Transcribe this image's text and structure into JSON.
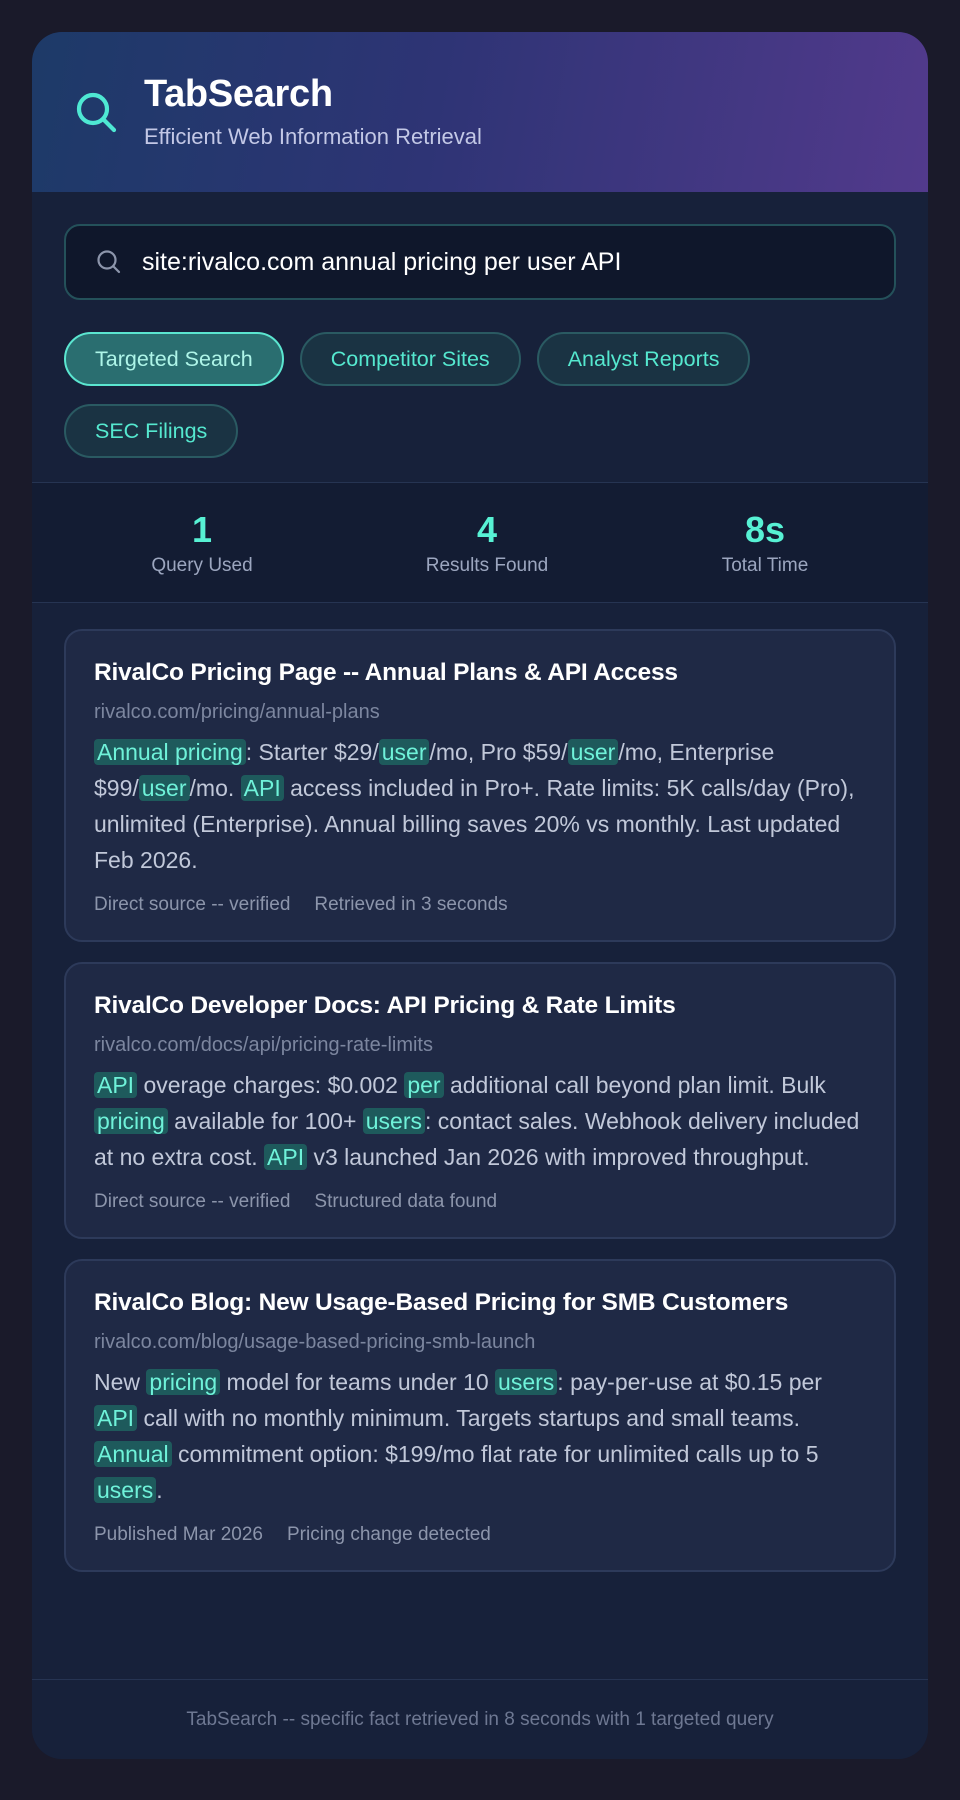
{
  "app": {
    "title": "TabSearch",
    "subtitle": "Efficient Web Information Retrieval",
    "logo_icon": "search-icon"
  },
  "search": {
    "query": "site:rivalco.com annual pricing per user API",
    "icon": "search-icon"
  },
  "filters": [
    {
      "label": "Targeted Search",
      "active": true
    },
    {
      "label": "Competitor Sites",
      "active": false
    },
    {
      "label": "Analyst Reports",
      "active": false
    },
    {
      "label": "SEC Filings",
      "active": false
    }
  ],
  "stats": [
    {
      "value": "1",
      "label": "Query Used"
    },
    {
      "value": "4",
      "label": "Results Found"
    },
    {
      "value": "8s",
      "label": "Total Time"
    }
  ],
  "results": [
    {
      "title": "RivalCo Pricing Page -- Annual Plans & API Access",
      "url": "rivalco.com/pricing/annual-plans",
      "snippet": [
        {
          "t": "Annual pricing",
          "h": true
        },
        {
          "t": ": Starter $29/"
        },
        {
          "t": "user",
          "h": true
        },
        {
          "t": "/mo, Pro $59/"
        },
        {
          "t": "user",
          "h": true
        },
        {
          "t": "/mo, Enterprise $99/"
        },
        {
          "t": "user",
          "h": true
        },
        {
          "t": "/mo. "
        },
        {
          "t": "API",
          "h": true
        },
        {
          "t": " access included in Pro+. Rate limits: 5K calls/day (Pro), unlimited (Enterprise). Annual billing saves 20% vs monthly. Last updated Feb 2026."
        }
      ],
      "meta": [
        "Direct source -- verified",
        "Retrieved in 3 seconds"
      ]
    },
    {
      "title": "RivalCo Developer Docs: API Pricing & Rate Limits",
      "url": "rivalco.com/docs/api/pricing-rate-limits",
      "snippet": [
        {
          "t": "API",
          "h": true
        },
        {
          "t": " overage charges: $0.002 "
        },
        {
          "t": "per",
          "h": true
        },
        {
          "t": " additional call beyond plan limit. Bulk "
        },
        {
          "t": "pricing",
          "h": true
        },
        {
          "t": " available for 100+ "
        },
        {
          "t": "users",
          "h": true
        },
        {
          "t": ": contact sales. Webhook delivery included at no extra cost. "
        },
        {
          "t": "API",
          "h": true
        },
        {
          "t": " v3 launched Jan 2026 with improved throughput."
        }
      ],
      "meta": [
        "Direct source -- verified",
        "Structured data found"
      ]
    },
    {
      "title": "RivalCo Blog: New Usage-Based Pricing for SMB Customers",
      "url": "rivalco.com/blog/usage-based-pricing-smb-launch",
      "snippet": [
        {
          "t": "New "
        },
        {
          "t": "pricing",
          "h": true
        },
        {
          "t": " model for teams under 10 "
        },
        {
          "t": "users",
          "h": true
        },
        {
          "t": ": pay-per-use at $0.15 per "
        },
        {
          "t": "API",
          "h": true
        },
        {
          "t": " call with no monthly minimum. Targets startups and small teams. "
        },
        {
          "t": "Annual",
          "h": true
        },
        {
          "t": " commitment option: $199/mo flat rate for unlimited calls up to 5 "
        },
        {
          "t": "users",
          "h": true
        },
        {
          "t": "."
        }
      ],
      "meta": [
        "Published Mar 2026",
        "Pricing change detected"
      ]
    }
  ],
  "footer": {
    "text": "TabSearch -- specific fact retrieved in 8 seconds with 1 targeted query"
  },
  "colors": {
    "accent": "#57f1d4",
    "header_start": "#1d3a68",
    "header_end": "#523a8c",
    "card_bg": "#1f2945",
    "highlight_bg": "#1e5a5c"
  }
}
